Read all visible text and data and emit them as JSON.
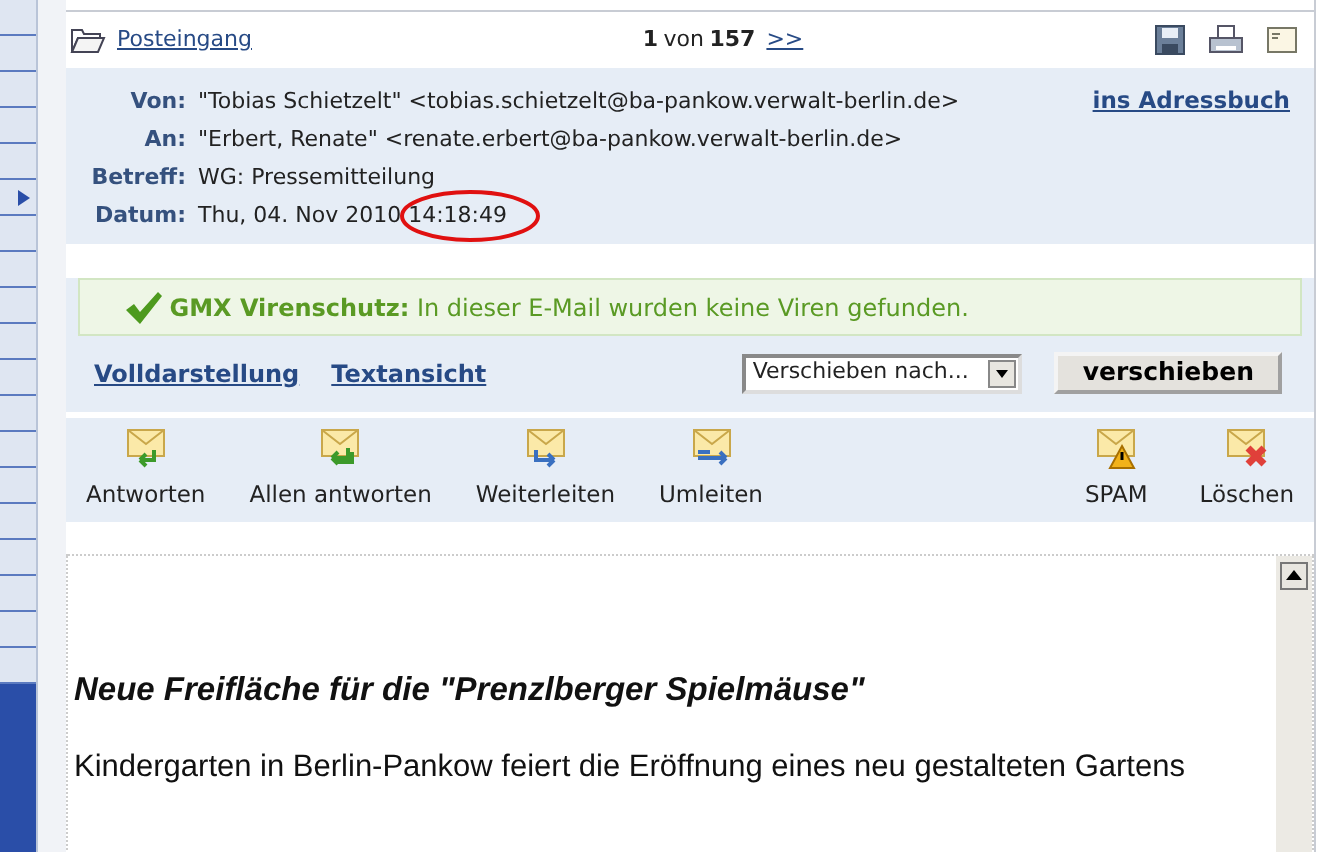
{
  "folder": {
    "label": "Posteingang"
  },
  "pager": {
    "current": "1",
    "separator": "von",
    "total": "157",
    "next": ">>"
  },
  "header_fields": [
    {
      "label": "Von:",
      "value": "\"Tobias Schietzelt\" <tobias.schietzelt@ba-pankow.verwalt-berlin.de>"
    },
    {
      "label": "An:",
      "value": "\"Erbert, Renate\" <renate.erbert@ba-pankow.verwalt-berlin.de>"
    },
    {
      "label": "Betreff:",
      "value": "WG: Pressemitteilung"
    },
    {
      "label": "Datum:",
      "value": "Thu, 04. Nov 2010 14:18:49"
    }
  ],
  "address_book_link": "ins Adressbuch",
  "virus_notice": {
    "title": "GMX Virenschutz:",
    "message": "In dieser E-Mail wurden keine Viren gefunden."
  },
  "view_links": [
    "Volldarstellung",
    "Textansicht"
  ],
  "move": {
    "select": "Verschieben nach...",
    "button": "verschieben"
  },
  "actions": [
    {
      "label": "Antworten",
      "kind": "reply"
    },
    {
      "label": "Allen antworten",
      "kind": "reply-all"
    },
    {
      "label": "Weiterleiten",
      "kind": "forward"
    },
    {
      "label": "Umleiten",
      "kind": "redirect"
    }
  ],
  "actions_right": [
    {
      "label": "SPAM",
      "kind": "spam"
    },
    {
      "label": "Löschen",
      "kind": "delete"
    }
  ],
  "message": {
    "headline": "Neue Freifläche für die \"Prenzlberger Spielmäuse\"",
    "subline": "Kindergarten in Berlin-Pankow feiert die Eröffnung eines neu gestalteten Gartens"
  }
}
